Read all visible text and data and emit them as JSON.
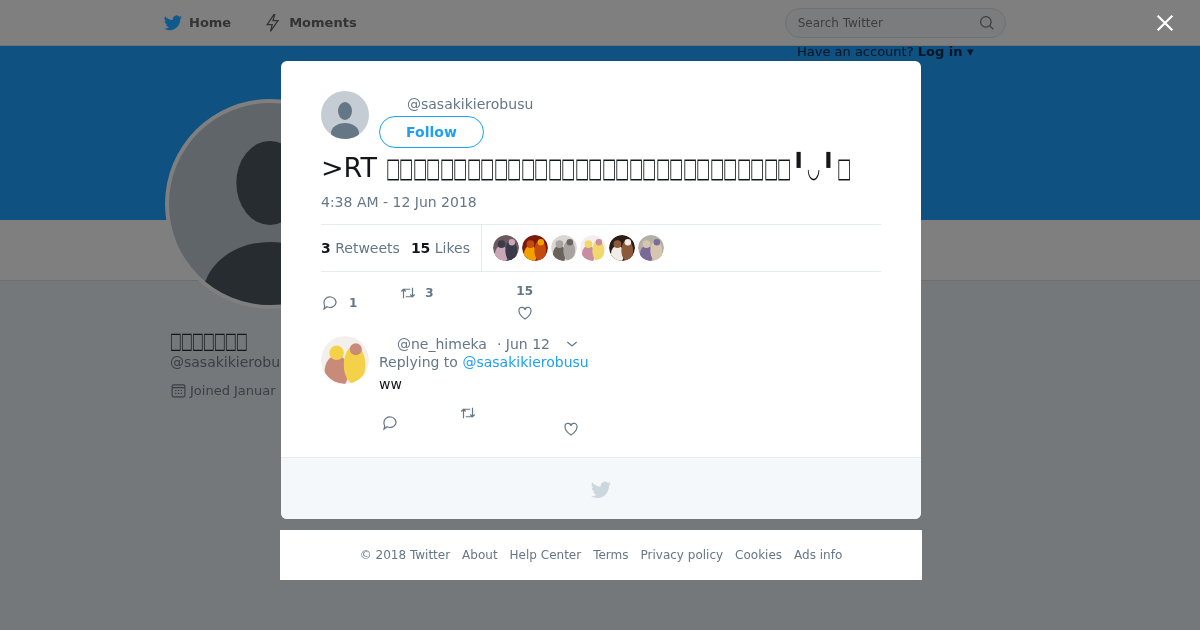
{
  "nav": {
    "items": [
      {
        "kind": "home",
        "label": "Home"
      },
      {
        "kind": "moments",
        "label": "Moments"
      }
    ],
    "search": {
      "placeholder": "Search Twitter"
    },
    "login": {
      "prompt": "Have an account?",
      "link": "Log in ▾"
    }
  },
  "profile": {
    "name": "□□□□□□□",
    "handle": "@sasakikierobu",
    "joined": "Joined Januar"
  },
  "tweet": {
    "handle": "@sasakikierobusu",
    "follow": "Follow",
    "text": ">RT  □□□□□□□□□□□□□□□□□□□□□□□□□□□□□□╹◡╹□",
    "time": "4:38 AM - 12 Jun 2018",
    "stats": [
      {
        "count": "3",
        "label": "Retweets"
      },
      {
        "count": "15",
        "label": "Likes"
      }
    ],
    "actions": [
      {
        "kind": "reply",
        "count": "1"
      },
      {
        "kind": "retweet",
        "count": "3"
      },
      {
        "kind": "like",
        "count": "15"
      }
    ]
  },
  "replies": [
    {
      "handle": "@ne_himeka",
      "date": "· Jun 12",
      "replying": "Replying to",
      "mention": "@sasakikierobusu",
      "text": "ww",
      "actions": [
        {
          "kind": "reply"
        },
        {
          "kind": "retweet"
        },
        {
          "kind": "like"
        }
      ]
    }
  ],
  "footer": {
    "links": [
      "© 2018 Twitter",
      "About",
      "Help Center",
      "Terms",
      "Privacy policy",
      "Cookies",
      "Ads info"
    ]
  }
}
